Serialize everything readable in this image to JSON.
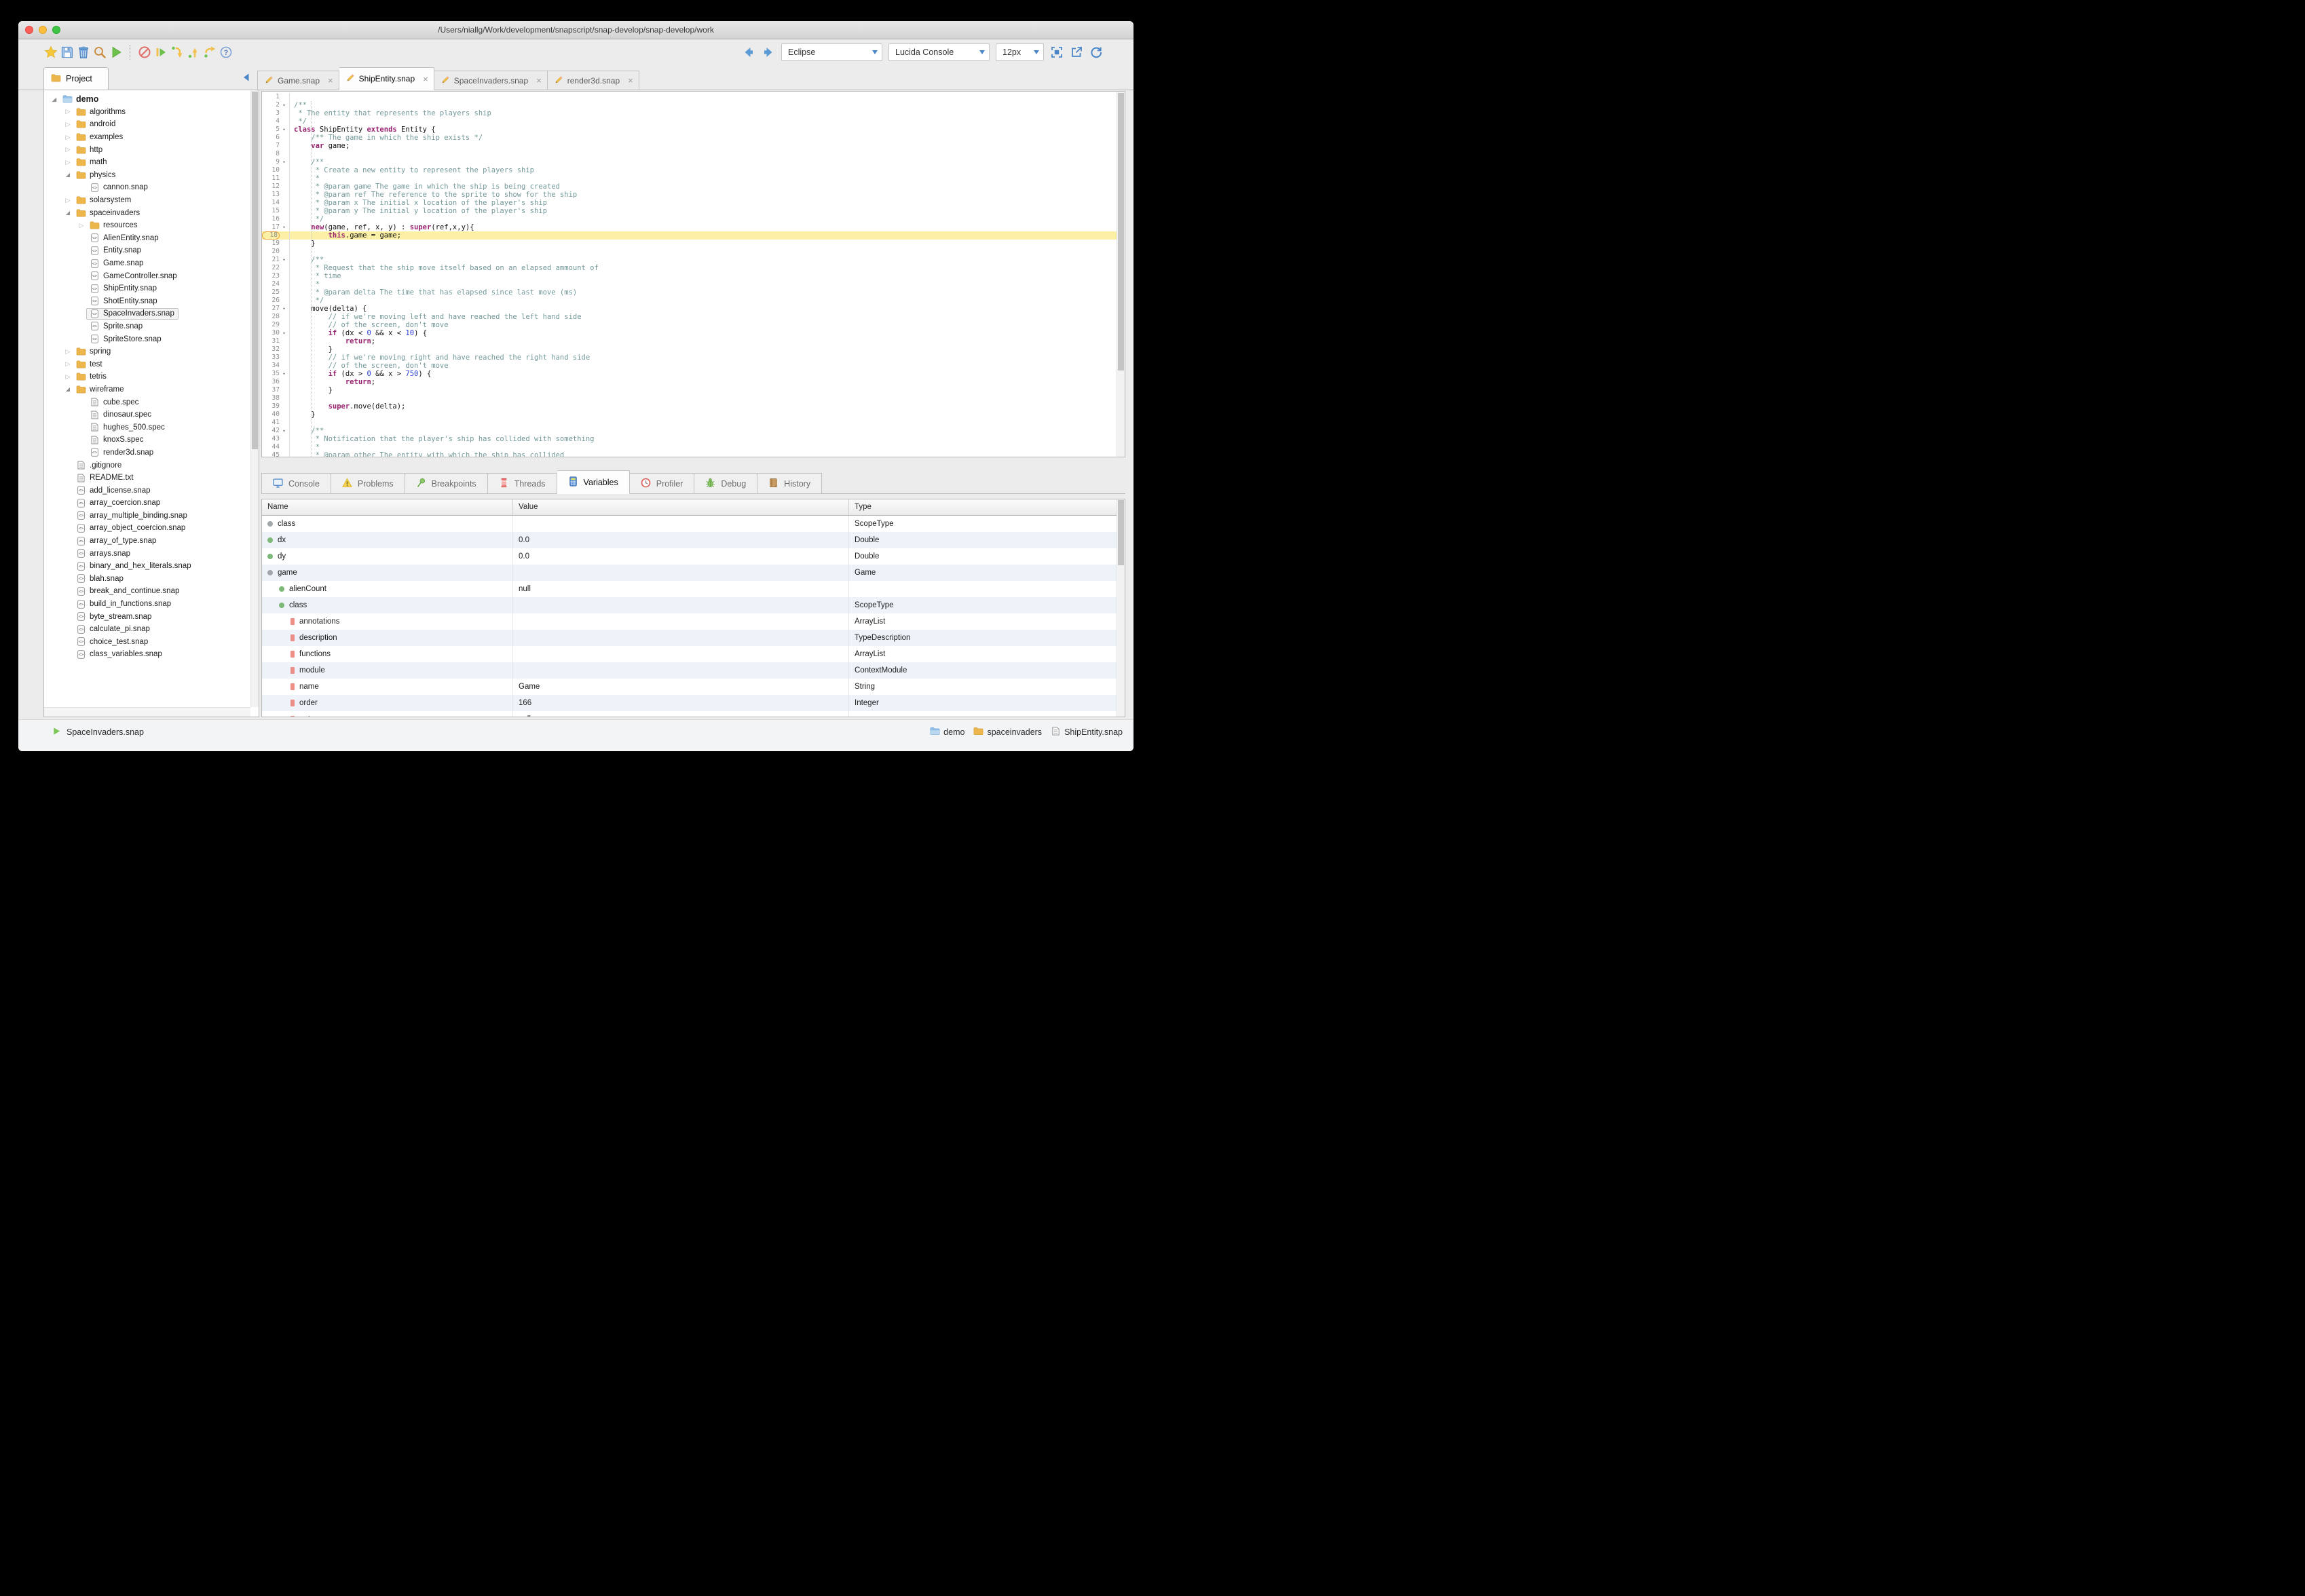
{
  "window": {
    "title": "/Users/niallg/Work/development/snapscript/snap-develop/snap-develop/work",
    "controls": [
      "close",
      "minimize",
      "zoom"
    ]
  },
  "toolbar": {
    "left_icons": [
      "star-icon",
      "save-icon",
      "trash-icon",
      "search-icon",
      "run-icon",
      "stop-icon",
      "resume-icon",
      "step-into-icon",
      "step-return-icon",
      "step-over-icon",
      "help-icon"
    ],
    "nav_icons": [
      "back-arrow-icon",
      "forward-arrow-icon"
    ],
    "theme": "Eclipse",
    "font": "Lucida Console",
    "size": "12px",
    "window_icons": [
      "fullscreen-icon",
      "export-icon",
      "refresh-icon"
    ]
  },
  "project_tab": {
    "label": "Project"
  },
  "editor_tabs": [
    {
      "label": "Game.snap",
      "active": false
    },
    {
      "label": "ShipEntity.snap",
      "active": true
    },
    {
      "label": "SpaceInvaders.snap",
      "active": false
    },
    {
      "label": "render3d.snap",
      "active": false
    }
  ],
  "tree": [
    {
      "label": "demo",
      "type": "folder-blue",
      "level": 0,
      "state": "expanded",
      "bold": true
    },
    {
      "label": "algorithms",
      "type": "folder",
      "level": 1,
      "state": "collapsed"
    },
    {
      "label": "android",
      "type": "folder",
      "level": 1,
      "state": "collapsed"
    },
    {
      "label": "examples",
      "type": "folder",
      "level": 1,
      "state": "collapsed"
    },
    {
      "label": "http",
      "type": "folder",
      "level": 1,
      "state": "collapsed"
    },
    {
      "label": "math",
      "type": "folder",
      "level": 1,
      "state": "collapsed"
    },
    {
      "label": "physics",
      "type": "folder",
      "level": 1,
      "state": "expanded"
    },
    {
      "label": "cannon.snap",
      "type": "code",
      "level": 2,
      "state": "none"
    },
    {
      "label": "solarsystem",
      "type": "folder",
      "level": 1,
      "state": "collapsed"
    },
    {
      "label": "spaceinvaders",
      "type": "folder",
      "level": 1,
      "state": "expanded"
    },
    {
      "label": "resources",
      "type": "folder",
      "level": 2,
      "state": "collapsed"
    },
    {
      "label": "AlienEntity.snap",
      "type": "code",
      "level": 2,
      "state": "none"
    },
    {
      "label": "Entity.snap",
      "type": "code",
      "level": 2,
      "state": "none"
    },
    {
      "label": "Game.snap",
      "type": "code",
      "level": 2,
      "state": "none"
    },
    {
      "label": "GameController.snap",
      "type": "code",
      "level": 2,
      "state": "none"
    },
    {
      "label": "ShipEntity.snap",
      "type": "code",
      "level": 2,
      "state": "none"
    },
    {
      "label": "ShotEntity.snap",
      "type": "code",
      "level": 2,
      "state": "none"
    },
    {
      "label": "SpaceInvaders.snap",
      "type": "code",
      "level": 2,
      "state": "none",
      "selected": true
    },
    {
      "label": "Sprite.snap",
      "type": "code",
      "level": 2,
      "state": "none"
    },
    {
      "label": "SpriteStore.snap",
      "type": "code",
      "level": 2,
      "state": "none"
    },
    {
      "label": "spring",
      "type": "folder",
      "level": 1,
      "state": "collapsed"
    },
    {
      "label": "test",
      "type": "folder",
      "level": 1,
      "state": "collapsed"
    },
    {
      "label": "tetris",
      "type": "folder",
      "level": 1,
      "state": "collapsed"
    },
    {
      "label": "wireframe",
      "type": "folder",
      "level": 1,
      "state": "expanded"
    },
    {
      "label": "cube.spec",
      "type": "doc",
      "level": 2,
      "state": "none"
    },
    {
      "label": "dinosaur.spec",
      "type": "doc",
      "level": 2,
      "state": "none"
    },
    {
      "label": "hughes_500.spec",
      "type": "doc",
      "level": 2,
      "state": "none"
    },
    {
      "label": "knoxS.spec",
      "type": "doc",
      "level": 2,
      "state": "none"
    },
    {
      "label": "render3d.snap",
      "type": "code",
      "level": 2,
      "state": "none"
    },
    {
      "label": ".gitignore",
      "type": "doc",
      "level": 1,
      "state": "none"
    },
    {
      "label": "README.txt",
      "type": "doc",
      "level": 1,
      "state": "none"
    },
    {
      "label": "add_license.snap",
      "type": "code",
      "level": 1,
      "state": "none"
    },
    {
      "label": "array_coercion.snap",
      "type": "code",
      "level": 1,
      "state": "none"
    },
    {
      "label": "array_multiple_binding.snap",
      "type": "code",
      "level": 1,
      "state": "none"
    },
    {
      "label": "array_object_coercion.snap",
      "type": "code",
      "level": 1,
      "state": "none"
    },
    {
      "label": "array_of_type.snap",
      "type": "code",
      "level": 1,
      "state": "none"
    },
    {
      "label": "arrays.snap",
      "type": "code",
      "level": 1,
      "state": "none"
    },
    {
      "label": "binary_and_hex_literals.snap",
      "type": "code",
      "level": 1,
      "state": "none"
    },
    {
      "label": "blah.snap",
      "type": "code",
      "level": 1,
      "state": "none"
    },
    {
      "label": "break_and_continue.snap",
      "type": "code",
      "level": 1,
      "state": "none"
    },
    {
      "label": "build_in_functions.snap",
      "type": "code",
      "level": 1,
      "state": "none"
    },
    {
      "label": "byte_stream.snap",
      "type": "code",
      "level": 1,
      "state": "none"
    },
    {
      "label": "calculate_pi.snap",
      "type": "code",
      "level": 1,
      "state": "none"
    },
    {
      "label": "choice_test.snap",
      "type": "code",
      "level": 1,
      "state": "none"
    },
    {
      "label": "class_variables.snap",
      "type": "code",
      "level": 1,
      "state": "none"
    }
  ],
  "editor": {
    "highlight_color": "#fbf0a5",
    "lines": [
      {
        "n": 1,
        "fold": false,
        "hl": false,
        "t": []
      },
      {
        "n": 2,
        "fold": true,
        "hl": false,
        "t": [
          [
            "c",
            "/**"
          ]
        ]
      },
      {
        "n": 3,
        "fold": false,
        "hl": false,
        "t": [
          [
            "c",
            " * The entity that represents the players ship"
          ]
        ]
      },
      {
        "n": 4,
        "fold": false,
        "hl": false,
        "t": [
          [
            "c",
            " */"
          ]
        ]
      },
      {
        "n": 5,
        "fold": true,
        "hl": false,
        "t": [
          [
            "k",
            "class"
          ],
          [
            "p",
            " ShipEntity "
          ],
          [
            "k",
            "extends"
          ],
          [
            "p",
            " Entity {"
          ]
        ]
      },
      {
        "n": 6,
        "fold": false,
        "hl": false,
        "t": [
          [
            "c",
            "    /** The game in which the ship exists */"
          ]
        ]
      },
      {
        "n": 7,
        "fold": false,
        "hl": false,
        "t": [
          [
            "p",
            "    "
          ],
          [
            "k",
            "var"
          ],
          [
            "p",
            " game;"
          ]
        ]
      },
      {
        "n": 8,
        "fold": false,
        "hl": false,
        "t": []
      },
      {
        "n": 9,
        "fold": true,
        "hl": false,
        "t": [
          [
            "c",
            "    /**"
          ]
        ]
      },
      {
        "n": 10,
        "fold": false,
        "hl": false,
        "t": [
          [
            "c",
            "     * Create a new entity to represent the players ship"
          ]
        ]
      },
      {
        "n": 11,
        "fold": false,
        "hl": false,
        "t": [
          [
            "c",
            "     *"
          ]
        ]
      },
      {
        "n": 12,
        "fold": false,
        "hl": false,
        "t": [
          [
            "c",
            "     * @param game The game in which the ship is being created"
          ]
        ]
      },
      {
        "n": 13,
        "fold": false,
        "hl": false,
        "t": [
          [
            "c",
            "     * @param ref The reference to the sprite to show for the ship"
          ]
        ]
      },
      {
        "n": 14,
        "fold": false,
        "hl": false,
        "t": [
          [
            "c",
            "     * @param x The initial x location of the player's ship"
          ]
        ]
      },
      {
        "n": 15,
        "fold": false,
        "hl": false,
        "t": [
          [
            "c",
            "     * @param y The initial y location of the player's ship"
          ]
        ]
      },
      {
        "n": 16,
        "fold": false,
        "hl": false,
        "t": [
          [
            "c",
            "     */"
          ]
        ]
      },
      {
        "n": 17,
        "fold": true,
        "hl": false,
        "t": [
          [
            "p",
            "    "
          ],
          [
            "k",
            "new"
          ],
          [
            "p",
            "(game, ref, x, y) : "
          ],
          [
            "k",
            "super"
          ],
          [
            "p",
            "(ref,x,y){"
          ]
        ]
      },
      {
        "n": 18,
        "fold": false,
        "hl": true,
        "t": [
          [
            "p",
            "        "
          ],
          [
            "k",
            "this"
          ],
          [
            "p",
            ".game = game;"
          ]
        ]
      },
      {
        "n": 19,
        "fold": false,
        "hl": false,
        "t": [
          [
            "p",
            "    }"
          ]
        ]
      },
      {
        "n": 20,
        "fold": false,
        "hl": false,
        "t": []
      },
      {
        "n": 21,
        "fold": true,
        "hl": false,
        "t": [
          [
            "c",
            "    /**"
          ]
        ]
      },
      {
        "n": 22,
        "fold": false,
        "hl": false,
        "t": [
          [
            "c",
            "     * Request that the ship move itself based on an elapsed ammount of"
          ]
        ]
      },
      {
        "n": 23,
        "fold": false,
        "hl": false,
        "t": [
          [
            "c",
            "     * time"
          ]
        ]
      },
      {
        "n": 24,
        "fold": false,
        "hl": false,
        "t": [
          [
            "c",
            "     *"
          ]
        ]
      },
      {
        "n": 25,
        "fold": false,
        "hl": false,
        "t": [
          [
            "c",
            "     * @param delta The time that has elapsed since last move (ms)"
          ]
        ]
      },
      {
        "n": 26,
        "fold": false,
        "hl": false,
        "t": [
          [
            "c",
            "     */"
          ]
        ]
      },
      {
        "n": 27,
        "fold": true,
        "hl": false,
        "t": [
          [
            "p",
            "    move(delta) {"
          ]
        ]
      },
      {
        "n": 28,
        "fold": false,
        "hl": false,
        "t": [
          [
            "c",
            "        // if we're moving left and have reached the left hand side"
          ]
        ]
      },
      {
        "n": 29,
        "fold": false,
        "hl": false,
        "t": [
          [
            "c",
            "        // of the screen, don't move"
          ]
        ]
      },
      {
        "n": 30,
        "fold": true,
        "hl": false,
        "t": [
          [
            "p",
            "        "
          ],
          [
            "k",
            "if"
          ],
          [
            "p",
            " (dx < "
          ],
          [
            "n",
            "0"
          ],
          [
            "p",
            " && x < "
          ],
          [
            "n",
            "10"
          ],
          [
            "p",
            ") {"
          ]
        ]
      },
      {
        "n": 31,
        "fold": false,
        "hl": false,
        "t": [
          [
            "p",
            "            "
          ],
          [
            "k",
            "return"
          ],
          [
            "p",
            ";"
          ]
        ]
      },
      {
        "n": 32,
        "fold": false,
        "hl": false,
        "t": [
          [
            "p",
            "        }"
          ]
        ]
      },
      {
        "n": 33,
        "fold": false,
        "hl": false,
        "t": [
          [
            "c",
            "        // if we're moving right and have reached the right hand side"
          ]
        ]
      },
      {
        "n": 34,
        "fold": false,
        "hl": false,
        "t": [
          [
            "c",
            "        // of the screen, don't move"
          ]
        ]
      },
      {
        "n": 35,
        "fold": true,
        "hl": false,
        "t": [
          [
            "p",
            "        "
          ],
          [
            "k",
            "if"
          ],
          [
            "p",
            " (dx > "
          ],
          [
            "n",
            "0"
          ],
          [
            "p",
            " && x > "
          ],
          [
            "n",
            "750"
          ],
          [
            "p",
            ") {"
          ]
        ]
      },
      {
        "n": 36,
        "fold": false,
        "hl": false,
        "t": [
          [
            "p",
            "            "
          ],
          [
            "k",
            "return"
          ],
          [
            "p",
            ";"
          ]
        ]
      },
      {
        "n": 37,
        "fold": false,
        "hl": false,
        "t": [
          [
            "p",
            "        }"
          ]
        ]
      },
      {
        "n": 38,
        "fold": false,
        "hl": false,
        "t": []
      },
      {
        "n": 39,
        "fold": false,
        "hl": false,
        "t": [
          [
            "p",
            "        "
          ],
          [
            "k",
            "super"
          ],
          [
            "p",
            ".move(delta);"
          ]
        ]
      },
      {
        "n": 40,
        "fold": false,
        "hl": false,
        "t": [
          [
            "p",
            "    }"
          ]
        ]
      },
      {
        "n": 41,
        "fold": false,
        "hl": false,
        "t": []
      },
      {
        "n": 42,
        "fold": true,
        "hl": false,
        "t": [
          [
            "c",
            "    /**"
          ]
        ]
      },
      {
        "n": 43,
        "fold": false,
        "hl": false,
        "t": [
          [
            "c",
            "     * Notification that the player's ship has collided with something"
          ]
        ]
      },
      {
        "n": 44,
        "fold": false,
        "hl": false,
        "t": [
          [
            "c",
            "     *"
          ]
        ]
      },
      {
        "n": 45,
        "fold": false,
        "hl": false,
        "t": [
          [
            "c",
            "     * @param other The entity with which the ship has collided"
          ]
        ]
      }
    ]
  },
  "bottom_tabs": [
    {
      "label": "Console",
      "icon": "console",
      "active": false
    },
    {
      "label": "Problems",
      "icon": "problems",
      "active": false
    },
    {
      "label": "Breakpoints",
      "icon": "breakpoints",
      "active": false
    },
    {
      "label": "Threads",
      "icon": "threads",
      "active": false
    },
    {
      "label": "Variables",
      "icon": "variables",
      "active": true
    },
    {
      "label": "Profiler",
      "icon": "profiler",
      "active": false
    },
    {
      "label": "Debug",
      "icon": "debug",
      "active": false
    },
    {
      "label": "History",
      "icon": "history",
      "active": false
    }
  ],
  "variables": {
    "columns": [
      "Name",
      "Value",
      "Type"
    ],
    "rows": [
      {
        "name": "class",
        "value": "",
        "type": "ScopeType",
        "marker": "gray",
        "level": 0
      },
      {
        "name": "dx",
        "value": "0.0",
        "type": "Double",
        "marker": "green",
        "level": 0
      },
      {
        "name": "dy",
        "value": "0.0",
        "type": "Double",
        "marker": "green",
        "level": 0
      },
      {
        "name": "game",
        "value": "",
        "type": "Game",
        "marker": "gray",
        "level": 0
      },
      {
        "name": "alienCount",
        "value": "null",
        "type": "",
        "marker": "green",
        "level": 1
      },
      {
        "name": "class",
        "value": "",
        "type": "ScopeType",
        "marker": "green",
        "level": 1
      },
      {
        "name": "annotations",
        "value": "",
        "type": "ArrayList",
        "marker": "red",
        "level": 2
      },
      {
        "name": "description",
        "value": "",
        "type": "TypeDescription",
        "marker": "red",
        "level": 2
      },
      {
        "name": "functions",
        "value": "",
        "type": "ArrayList",
        "marker": "red",
        "level": 2
      },
      {
        "name": "module",
        "value": "",
        "type": "ContextModule",
        "marker": "red",
        "level": 2
      },
      {
        "name": "name",
        "value": "Game",
        "type": "String",
        "marker": "red",
        "level": 2
      },
      {
        "name": "order",
        "value": "166",
        "type": "Integer",
        "marker": "red",
        "level": 2
      },
      {
        "name": "outer",
        "value": "null",
        "type": "",
        "marker": "red",
        "level": 2
      }
    ]
  },
  "status": {
    "run_label": "SpaceInvaders.snap",
    "breadcrumb": [
      {
        "label": "demo",
        "icon": "folder-blue"
      },
      {
        "label": "spaceinvaders",
        "icon": "folder"
      },
      {
        "label": "ShipEntity.snap",
        "icon": "doc"
      }
    ]
  },
  "colors": {
    "keyword": "#97236f",
    "comment": "#739899",
    "number": "#2a3bd6",
    "line_highlight": "#fbf0a5",
    "accent_blue": "#4a86c8",
    "folder_yellow": "#ecb64d",
    "run_green": "#6cc24a"
  }
}
